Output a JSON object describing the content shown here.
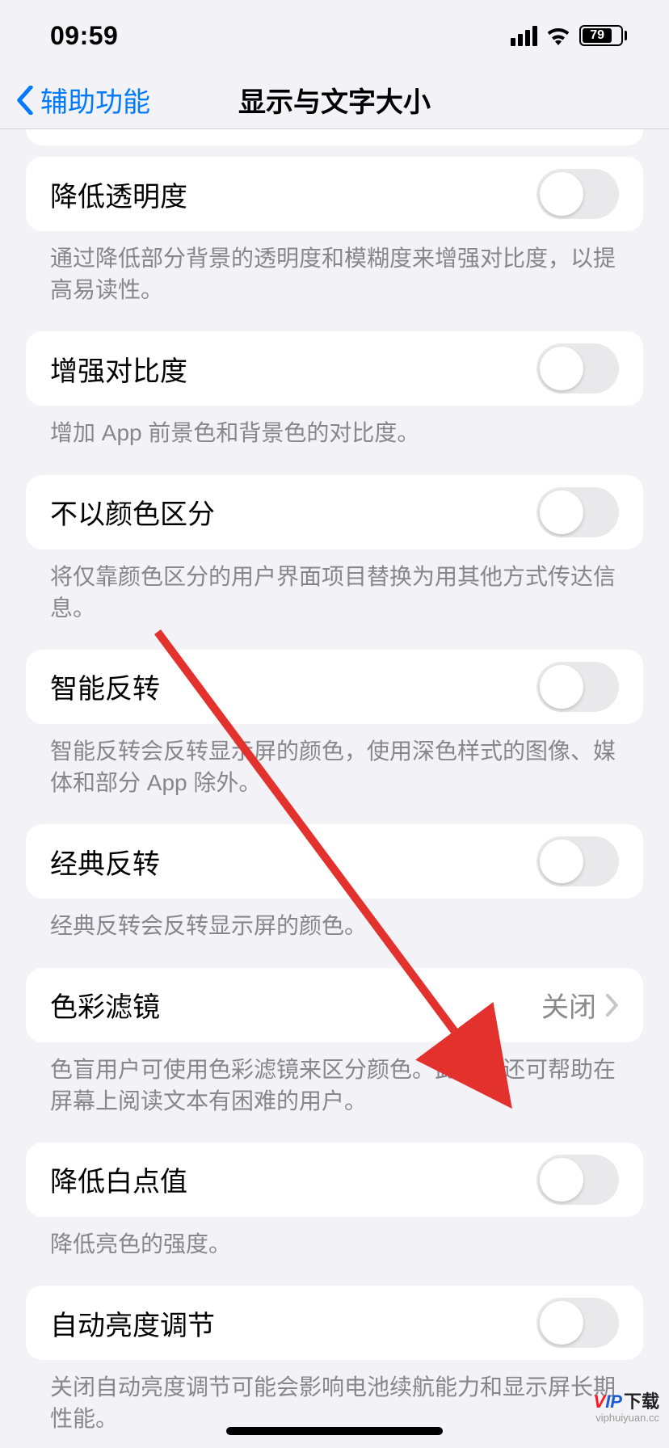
{
  "status": {
    "time": "09:59",
    "battery_pct": "79"
  },
  "nav": {
    "back": "辅助功能",
    "title": "显示与文字大小"
  },
  "rows": {
    "reduce_transparency": {
      "label": "降低透明度",
      "desc": "通过降低部分背景的透明度和模糊度来增强对比度，以提高易读性。"
    },
    "increase_contrast": {
      "label": "增强对比度",
      "desc": "增加 App 前景色和背景色的对比度。"
    },
    "diff_without_color": {
      "label": "不以颜色区分",
      "desc": "将仅靠颜色区分的用户界面项目替换为用其他方式传达信息。"
    },
    "smart_invert": {
      "label": "智能反转",
      "desc": "智能反转会反转显示屏的颜色，使用深色样式的图像、媒体和部分 App 除外。"
    },
    "classic_invert": {
      "label": "经典反转",
      "desc": "经典反转会反转显示屏的颜色。"
    },
    "color_filters": {
      "label": "色彩滤镜",
      "value": "关闭",
      "desc": "色盲用户可使用色彩滤镜来区分颜色。此功能还可帮助在屏幕上阅读文本有困难的用户。"
    },
    "reduce_white_point": {
      "label": "降低白点值",
      "desc": "降低亮色的强度。"
    },
    "auto_brightness": {
      "label": "自动亮度调节",
      "desc": "关闭自动亮度调节可能会影响电池续航能力和显示屏长期性能。"
    }
  },
  "watermark": {
    "brand_v": "V",
    "brand_ip": "IP",
    "dl": "下载",
    "url": "viphuiyuan.cc"
  }
}
